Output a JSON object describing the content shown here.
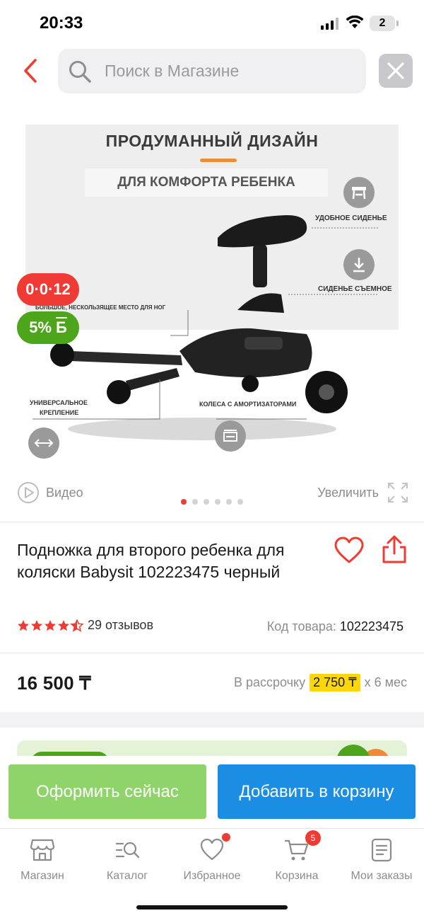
{
  "status_bar": {
    "time": "20:33",
    "battery": "2"
  },
  "search": {
    "placeholder": "Поиск в Магазине"
  },
  "product_image": {
    "title": "ПРОДУМАННЫЙ ДИЗАЙН",
    "subtitle": "ДЛЯ КОМФОРТА РЕБЕНКА",
    "callouts": {
      "seat": "УДОБНОЕ СИДЕНЬЕ",
      "removable": "СИДЕНЬЕ СЪЕМНОЕ",
      "footrest": "БОЛЬШОЕ, НЕСКОЛЬЗЯЩЕЕ МЕСТО ДЛЯ НОГ",
      "mount_line1": "УНИВЕРСАЛЬНОЕ",
      "mount_line2": "КРЕПЛЕНИЕ",
      "wheels": "КОЛЕСА С АМОРТИЗАТОРАМИ"
    }
  },
  "badges": {
    "timer": "0·0·12",
    "bonus_percent": "5%",
    "bonus_symbol": "Б"
  },
  "media": {
    "video_label": "Видео",
    "zoom_label": "Увеличить",
    "slide_count": 6,
    "active_slide": 1
  },
  "product": {
    "title": "Подножка для второго ребенка для коляски Babysit 102223475 черный",
    "rating": 4.5,
    "reviews": "29 отзывов",
    "sku_label": "Код товара:",
    "sku_value": "102223475",
    "price": "16 500 ₸",
    "installment_prefix": "В рассрочку",
    "installment_amount": "2 750 ₸",
    "installment_suffix": "х 6 мес"
  },
  "actions": {
    "buy_now": "Оформить сейчас",
    "add_to_cart": "Добавить в корзину"
  },
  "tab_bar": {
    "shop": "Магазин",
    "catalog": "Каталог",
    "favorites": "Избранное",
    "cart": "Корзина",
    "cart_count": "5",
    "orders": "Мои заказы"
  },
  "colors": {
    "accent_red": "#ef3b33",
    "green": "#4da51c",
    "blue": "#1b8ee3",
    "yellow": "#ffd60a"
  }
}
